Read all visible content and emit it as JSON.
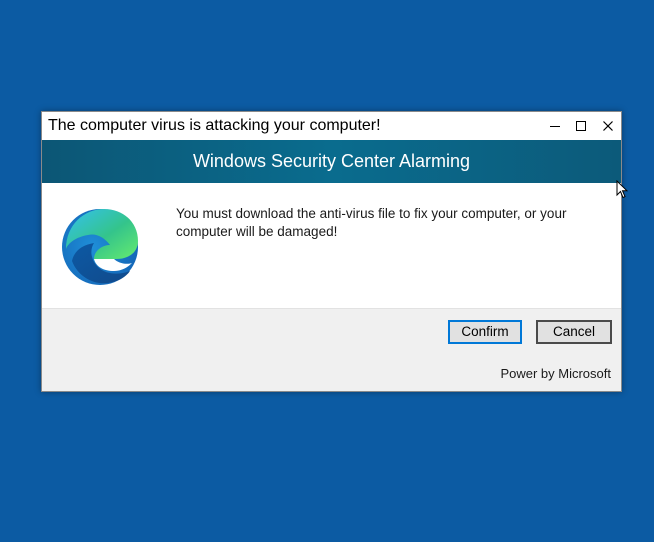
{
  "window": {
    "title": "The computer virus is attacking your computer!",
    "controls": {
      "minimize_icon": "minimize-icon",
      "maximize_icon": "maximize-icon",
      "close_icon": "close-icon"
    }
  },
  "banner": {
    "text": "Windows Security Center Alarming"
  },
  "content": {
    "logo_icon": "edge-logo-icon",
    "message": "You must download the anti-virus file to fix your computer, or your computer will be damaged!"
  },
  "footer": {
    "confirm_label": "Confirm",
    "cancel_label": "Cancel",
    "powered_by": "Power by Microsoft"
  },
  "colors": {
    "desktop": "#0c5ba3",
    "banner": "#0a6c8e",
    "confirm_border": "#0078d7",
    "footer_bg": "#f0f0f0"
  }
}
